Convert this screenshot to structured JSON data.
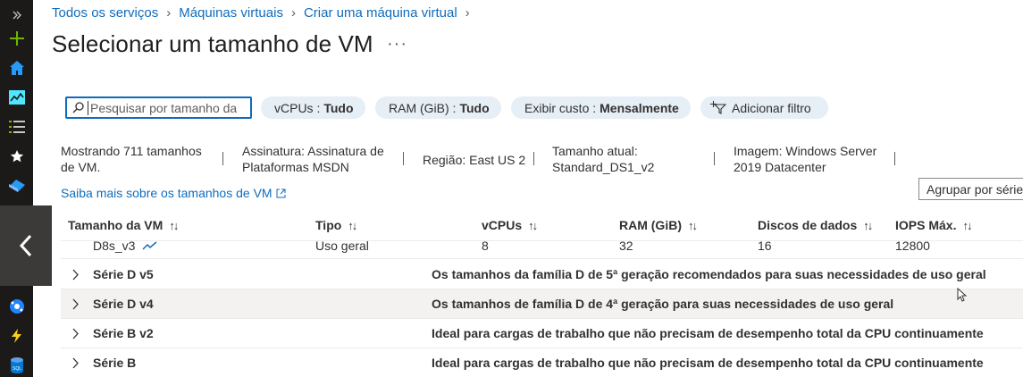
{
  "breadcrumb": [
    "Todos os serviços",
    "Máquinas virtuais",
    "Criar uma máquina virtual"
  ],
  "title": "Selecionar um tamanho de VM",
  "title_more": "···",
  "search": {
    "placeholder": "Pesquisar por tamanho da"
  },
  "filters": {
    "vcpus": {
      "label": "vCPUs :",
      "value": "Tudo"
    },
    "ram": {
      "label": "RAM (GiB) :",
      "value": "Tudo"
    },
    "cost": {
      "label": "Exibir custo :",
      "value": "Mensalmente"
    },
    "add": "Adicionar filtro"
  },
  "info": {
    "showing_1": "Mostrando 711 tamanhos",
    "showing_2": "de VM.",
    "subscription_1": "Assinatura: Assinatura de",
    "subscription_2": "Plataformas MSDN",
    "region": "Região: East US 2",
    "current_size_1": "Tamanho atual:",
    "current_size_2": "Standard_DS1_v2",
    "image_1": "Imagem: Windows Server",
    "image_2": "2019 Datacenter"
  },
  "learn_more": "Saiba mais sobre os tamanhos de VM",
  "group_by": "Agrupar por série",
  "columns": [
    "Tamanho da VM",
    "Tipo",
    "vCPUs",
    "RAM (GiB)",
    "Discos de dados",
    "IOPS Máx."
  ],
  "partial_row": {
    "size": "D8s_v3",
    "type": "Uso geral",
    "vcpus": "8",
    "ram": "32",
    "disks": "16",
    "iops": "12800"
  },
  "groups": [
    {
      "name": "Série D v5",
      "desc": "Os tamanhos da família D de 5ª geração recomendados para suas necessidades de uso geral"
    },
    {
      "name": "Série D v4",
      "desc": "Os tamanhos de família D de 4ª geração para suas necessidades de uso geral"
    },
    {
      "name": "Série B v2",
      "desc": "Ideal para cargas de trabalho que não precisam de desempenho total da CPU continuamente"
    },
    {
      "name": "Série B",
      "desc": "Ideal para cargas de trabalho que não precisam de desempenho total da CPU continuamente"
    }
  ],
  "colors": {
    "accent": "#0f6cbd",
    "rail": "#1b1a19",
    "pill": "#e6eef6"
  }
}
